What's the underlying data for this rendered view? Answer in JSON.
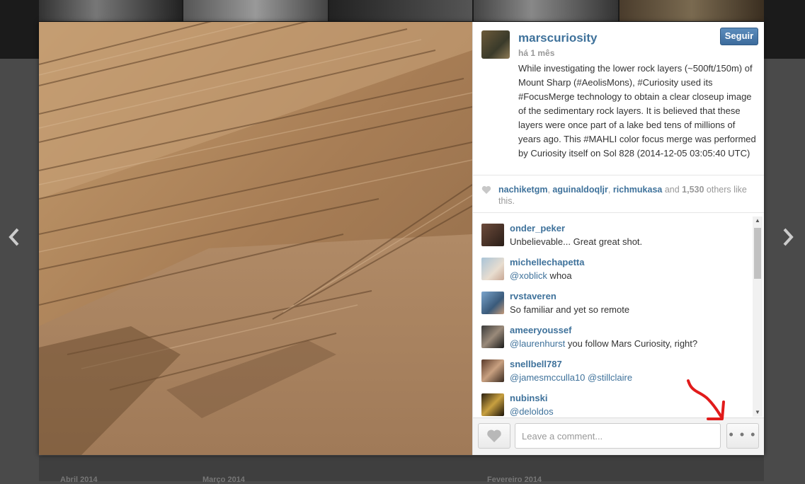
{
  "post": {
    "username": "marscuriosity",
    "time": "há 1 mês",
    "follow_label": "Seguir",
    "caption": "While investigating the lower rock layers (~500ft/150m) of Mount Sharp (#AeolisMons), #Curiosity used its #FocusMerge technology to obtain a clear closeup image of the sedimentary rock layers. It is believed that these layers were once part of a lake bed tens of millions of years ago. This #MAHLI color focus merge was performed by Curiosity itself on Sol 828 (2014-12-05 03:05:40 UTC)"
  },
  "likes": {
    "users": [
      "nachiketgm",
      "aguinaldoqljr",
      "richmukasa"
    ],
    "sep1": ", ",
    "sep2": ", ",
    "and": " and ",
    "count": "1,530",
    "suffix": " others like this."
  },
  "comments": [
    {
      "user": "onder_peker",
      "mention": "",
      "text": "Unbelievable... Great great shot."
    },
    {
      "user": "michellechapetta",
      "mention": "@xoblick",
      "text": " whoa"
    },
    {
      "user": "rvstaveren",
      "mention": "",
      "text": "So familiar and yet so remote"
    },
    {
      "user": "ameeryoussef",
      "mention": "@laurenhurst",
      "text": " you follow Mars Curiosity, right?"
    },
    {
      "user": "snellbell787",
      "mention": "@jamesmcculla10 @stillclaire",
      "text": ""
    },
    {
      "user": "nubinski",
      "mention": "@deloldos",
      "text": ""
    }
  ],
  "footer": {
    "comment_placeholder": "Leave a comment...",
    "more_label": "• • •"
  },
  "background": {
    "months": [
      "Abril 2014",
      "Março 2014",
      "Fevereiro 2014"
    ]
  },
  "colors": {
    "link": "#3f729b",
    "follow_button": "#3c6b9c",
    "annotation_arrow": "#e11b1b"
  },
  "icons": {
    "prev": "chevron-left-icon",
    "next": "chevron-right-icon",
    "like": "heart-icon"
  }
}
